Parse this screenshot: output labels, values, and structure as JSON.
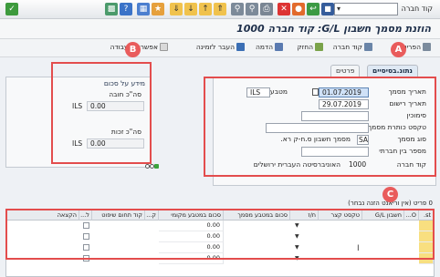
{
  "toolbar": {
    "left_icons": [
      "command-field",
      "yellow-square-icon",
      "help-icon",
      "find-icon"
    ],
    "right_label": "קוד חברה",
    "tooltip": "Save"
  },
  "title": "הוזנת מסמך חשבון G/L: קוד חברה 1000",
  "app_toolbar": {
    "items": [
      "הפריט",
      "קוד חברה",
      "החזק",
      "הדמה",
      "העבר לזמינה",
      "אפשרויות עבודה"
    ]
  },
  "badges": {
    "a": "A",
    "b": "B",
    "c": "C"
  },
  "tabs": {
    "active": "נתונ.בסיסיים",
    "inactive": "פרטים"
  },
  "form": {
    "doc_date_label": "תאריך מסמך",
    "doc_date_value": "01.07.2019",
    "currency_label": "מטבע",
    "currency_value": "ILS",
    "post_date_label": "תאריך רישום",
    "post_date_value": "29.07.2019",
    "reference_label": "סימוכין",
    "header_text_label": "טקסט כותרת מסמך",
    "doc_type_label": "סוג מסמך",
    "doc_type_value": "SA",
    "doc_type_desc": "מסמך חשבון ס.ח-ק רא.",
    "cross_cc_label": "מספר בין חברתי",
    "company_label": "קוד חברה",
    "company_value": "1000",
    "company_name": "האוניברסיטה העברית ירושלים"
  },
  "balance": {
    "heading": "מידע על סכום",
    "debit_label": "סה\"כ חובה",
    "debit_currency": "ILS",
    "debit_value": "0.00",
    "credit_label": "סה\"כ זכות",
    "credit_currency": "ILS",
    "credit_value": "0.00"
  },
  "grid": {
    "caption": "0 פריט (אין וריאנט הזנה נבחר)",
    "headers": [
      "st.",
      "O...",
      "חשבון G/L",
      "טקסט קצר",
      "ח/ז",
      "סכום במטבע מסמך",
      "סכום במטבע מקומי",
      "ק...",
      "קוד תחום שיפוט",
      "ל...",
      "הקצאה"
    ],
    "rows": [
      {
        "local_amount": "0.00"
      },
      {
        "local_amount": "0.00"
      },
      {
        "local_amount": "0.00"
      },
      {
        "local_amount": "0.00"
      }
    ]
  },
  "colors": {
    "accent": "#e34d4d",
    "tab_active": "#dfe9f4",
    "yellow_cell": "#f8df80"
  }
}
